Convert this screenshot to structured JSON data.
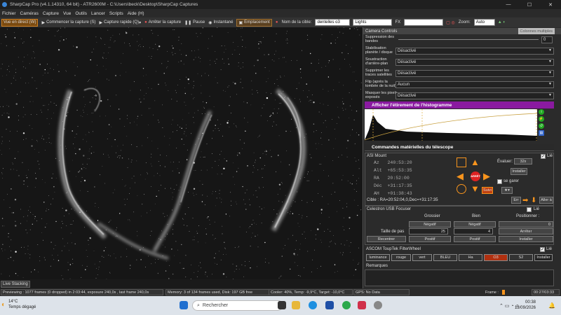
{
  "window": {
    "title": "SharpCap Pro (v4.1.14310, 64 bit) - ATR2600M - C:\\Users\\beck\\Desktop\\SharpCap Captures"
  },
  "menu": [
    "Fichier",
    "Caméras",
    "Capture",
    "Vue",
    "Outils",
    "Lancer",
    "Scripts",
    "Aide (H)"
  ],
  "toolbar": {
    "live": "Vue en direct (W)",
    "start": "Commencer la capture (S)",
    "quick": "Capture rapide (Q)",
    "stop": "Arrêter la capture",
    "pause": "Pause",
    "snapshot": "Instantané",
    "placement": "Emplacement",
    "target_label": "Nom de la cible:",
    "target_value": "dentelles o3",
    "frame_type": "Lights",
    "fx_label": "FX",
    "zoom_label": "Zoom:",
    "zoom_value": "Auto"
  },
  "panel": {
    "header": "Camera Controls",
    "multi_cols": "Colonnes multiples",
    "rows": [
      {
        "label": "Suppression des bandes",
        "value": "0"
      },
      {
        "label": "Stabilisation planète / disque",
        "value": "Désactivé"
      },
      {
        "label": "Soustraction d'arrière-plan",
        "value": "Désactivé"
      },
      {
        "label": "Supprimer les traces satellites",
        "value": "Désactivé"
      },
      {
        "label": "Flip (après la tombée de la nuit)",
        "value": "Aucun"
      },
      {
        "label": "Masquer les pixels exposés",
        "value": "Désactivé"
      }
    ],
    "histogram_title": "Afficher l'étirement de l'histogramme",
    "telescope_title": "Commandes matérielles du télescope"
  },
  "mount": {
    "name": "ASI Mount",
    "connected_label": "Lié",
    "az": "240:53:20",
    "alt": "+65:53:35",
    "ra": "20:52:00",
    "dec": "+31:17:35",
    "ah": "+01:38:43",
    "labels": {
      "az": "Az",
      "alt": "Alt",
      "ra": "RA",
      "dec": "Déc",
      "ah": "AH"
    },
    "eval_label": "Évaluer:",
    "eval_value": "32x",
    "install": "Installer",
    "park": "se garer",
    "follow": "Suivi",
    "stop": "ARRÊT",
    "target": "Cible : RA=20:52:04,0,Dec=+31:17:35",
    "err": "Err",
    "goto": "Aller à"
  },
  "focuser": {
    "name": "Celestron USB Focuser",
    "connected": "Lié",
    "coarse": "Grossier",
    "fine": "Bien",
    "position_label": "Positionner :",
    "negative": "Négatif",
    "positive": "Positif",
    "step_label": "Taille de pas",
    "coarse_step": "25",
    "fine_step": "4",
    "position_value": "0",
    "recenter": "Recentrer",
    "stop": "Arrêter",
    "install": "Installer"
  },
  "filterwheel": {
    "name": "ASCOM ToupTek FilterWheel",
    "connected": "Lié",
    "filters": [
      "luminance",
      "rouge",
      "vert",
      "BLEU",
      "Ha",
      "O3",
      "S2"
    ],
    "selected": "O3",
    "install": "Installer",
    "remarks": "Remarques"
  },
  "live_stacking": "Live Stacking",
  "status": {
    "preview": "Previewing : 1077 frames (0 dropped) in 2:03:44, exposure 240,0s , last frame 240,0s",
    "memory": "Memory: 3 of 134 frames used, Disk: 197 GB free",
    "cooler": "Cooler: 40%, Temp: -9,9°C, Target: -10,0°C",
    "gps": "GPS: No Data",
    "frame_label": "Frame :",
    "time": "00:27/03:33"
  },
  "taskbar": {
    "temp": "14°C",
    "weather": "Temps dégagé",
    "search": "Rechercher",
    "clock": "00:38",
    "date": "13/09/2026"
  },
  "colors": {
    "accent": "#f7941d",
    "histogram": "#8a1aa0",
    "stop": "#dd2222"
  }
}
